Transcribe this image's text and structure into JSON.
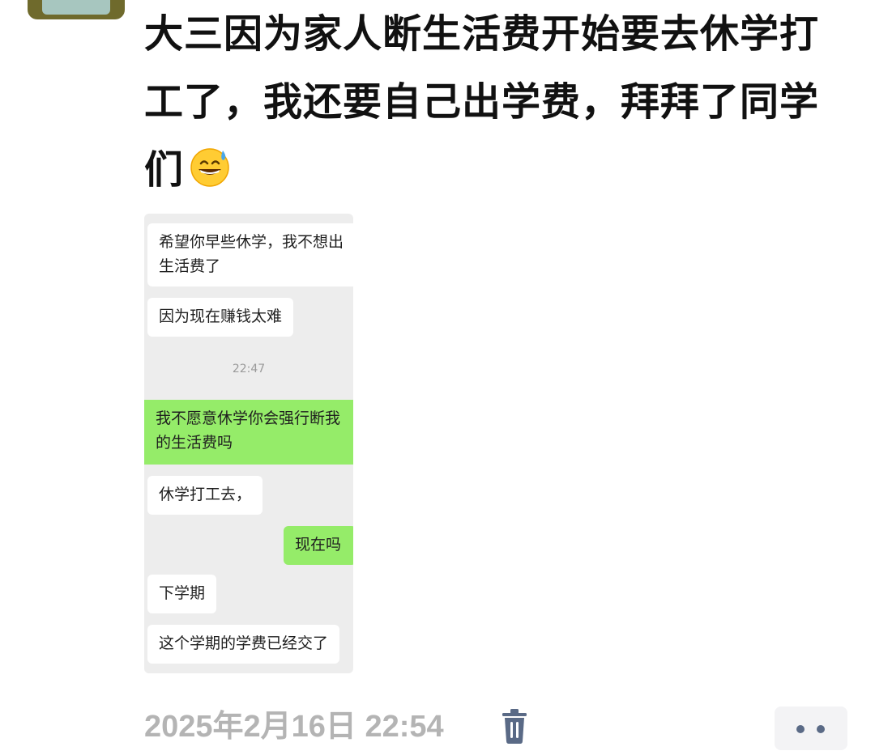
{
  "post": {
    "line1": "大三因为家人断生活费开始要去休学打",
    "line2": "工了，我还要自己出学费，拜拜了同学",
    "line3": "们",
    "emoji": "grinning-face-with-sweat"
  },
  "chat": {
    "messages": [
      {
        "side": "left",
        "line1": "希望你早些休学，我不想出",
        "line2": "生活费了"
      },
      {
        "side": "left",
        "text": "因为现在赚钱太难"
      },
      {
        "time": "22:47"
      },
      {
        "side": "right",
        "line1": "我不愿意休学你会强行断我",
        "line2": "的生活费吗"
      },
      {
        "side": "left",
        "text": "休学打工去，"
      },
      {
        "side": "right",
        "text": "现在吗"
      },
      {
        "side": "left",
        "text": "下学期"
      },
      {
        "side": "left",
        "text": "这个学期的学费已经交了"
      }
    ]
  },
  "footer": {
    "timestamp": "2025年2月16日 22:54",
    "delete_icon": "trash-icon",
    "more_icon": "more-dots-icon"
  },
  "colors": {
    "text": "#111111",
    "timestamp": "#b4b4b4",
    "chat_bg": "#ededed",
    "bubble_left": "#ffffff",
    "bubble_right": "#95ec69",
    "icon": "#5a6a86"
  }
}
